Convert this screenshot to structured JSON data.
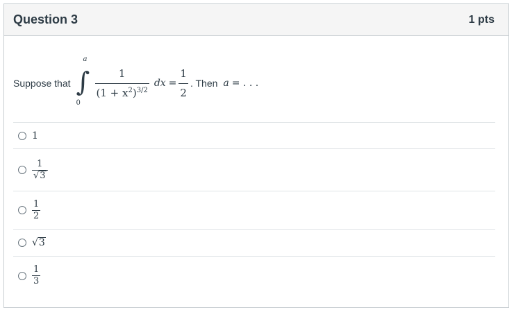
{
  "header": {
    "title": "Question 3",
    "points": "1 pts"
  },
  "stem": {
    "intro": "Suppose that",
    "upper_limit": "a",
    "lower_limit": "0",
    "numerator": "1",
    "denominator_base": "(1 + x",
    "denominator_sq": "2",
    "denominator_close": ")",
    "denominator_exp": "3/2",
    "differential": "dx",
    "equals": "=",
    "rhs_num": "1",
    "rhs_den": "2",
    "then_text": ". Then",
    "tail_var": "a",
    "tail_rest": "= . . ."
  },
  "answers": [
    {
      "kind": "plain",
      "text": "1"
    },
    {
      "kind": "frac_sqrt",
      "num": "1",
      "sqrt": "√",
      "radicand": "3"
    },
    {
      "kind": "frac",
      "num": "1",
      "den": "2"
    },
    {
      "kind": "sqrt",
      "sqrt": "√",
      "radicand": "3"
    },
    {
      "kind": "frac",
      "num": "1",
      "den": "3"
    }
  ]
}
